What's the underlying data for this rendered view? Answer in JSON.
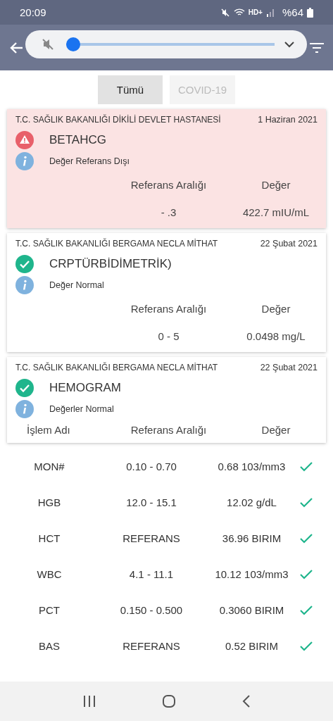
{
  "status_bar": {
    "time": "20:09",
    "network": "HD+",
    "battery": "%64"
  },
  "volume": {
    "muted": true,
    "level": 0.0
  },
  "filters": [
    {
      "label": "Tümü",
      "selected": true,
      "disabled": false
    },
    {
      "label": "COVID-19",
      "selected": false,
      "disabled": true
    }
  ],
  "results": [
    {
      "hospital": "T.C. SAĞLIK BAKANLIĞI DİKİLİ DEVLET HASTANESİ",
      "date": "1 Haziran 2021",
      "kind": "warning",
      "test": "BETAHCG",
      "note": "Değer Referans Dışı",
      "columns": [
        "Referans Aralığı",
        "Değer"
      ],
      "row": [
        "- .3",
        "422.7 mIU/mL"
      ]
    },
    {
      "hospital": "T.C. SAĞLIK BAKANLIĞI BERGAMA NECLA MİTHAT",
      "date": "22 Şubat 2021",
      "kind": "ok",
      "test": "CRPTÜRBİDİMETRİK)",
      "note": "Değer Normal",
      "columns": [
        "Referans Aralığı",
        "Değer"
      ],
      "row": [
        "0 - 5",
        "0.0498 mg/L"
      ]
    },
    {
      "hospital": "T.C. SAĞLIK BAKANLIĞI BERGAMA NECLA MİTHAT",
      "date": "22 Şubat 2021",
      "kind": "ok",
      "test": "HEMOGRAM",
      "note": "Değerler Normal",
      "columns": [
        "İşlem Adı",
        "Referans Aralığı",
        "Değer"
      ]
    }
  ],
  "hemogram_rows": [
    {
      "name": "MON#",
      "range": "0.10 - 0.70",
      "value": "0.68 103/mm3",
      "normal": true
    },
    {
      "name": "HGB",
      "range": "12.0 - 15.1",
      "value": "12.02 g/dL",
      "normal": true
    },
    {
      "name": "HCT",
      "range": "REFERANS",
      "value": "36.96 BIRIM",
      "normal": true
    },
    {
      "name": "WBC",
      "range": "4.1 - 11.1",
      "value": "10.12 103/mm3",
      "normal": true
    },
    {
      "name": "PCT",
      "range": "0.150 - 0.500",
      "value": "0.3060 BIRIM",
      "normal": true
    },
    {
      "name": "BAS",
      "range": "REFERANS",
      "value": "0.52 BIRIM",
      "normal": true
    }
  ]
}
